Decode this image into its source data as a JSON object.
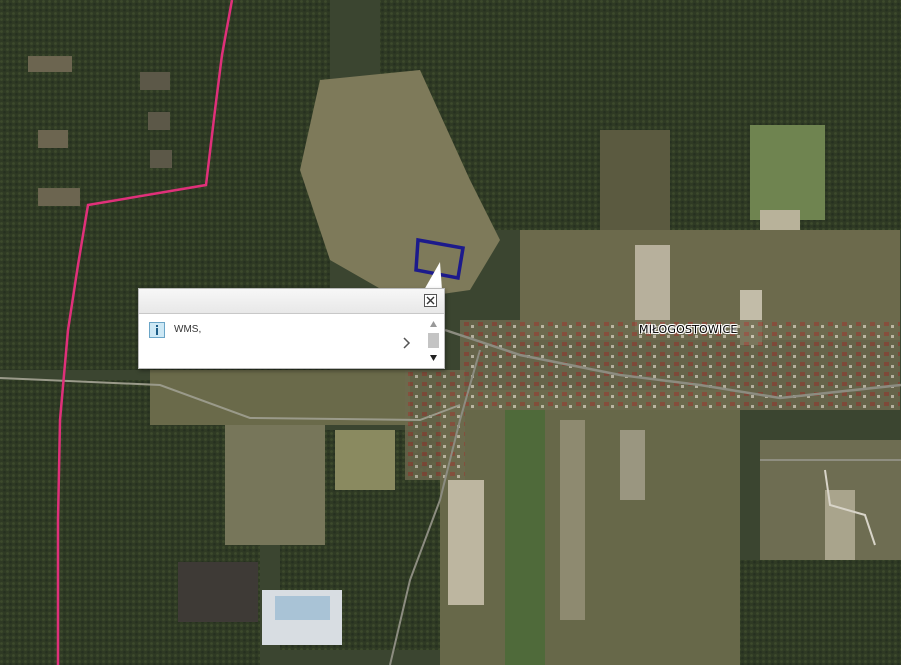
{
  "map": {
    "type": "satellite",
    "boundary_color": "#e0307a",
    "parcel_color": "#1c1a8c",
    "place_label": "MIŁOGOSTOWICE"
  },
  "popup": {
    "result_label": "WMS,",
    "info_icon": "info-icon",
    "close_icon": "close-icon",
    "chevron_icon": "chevron-right-icon"
  }
}
